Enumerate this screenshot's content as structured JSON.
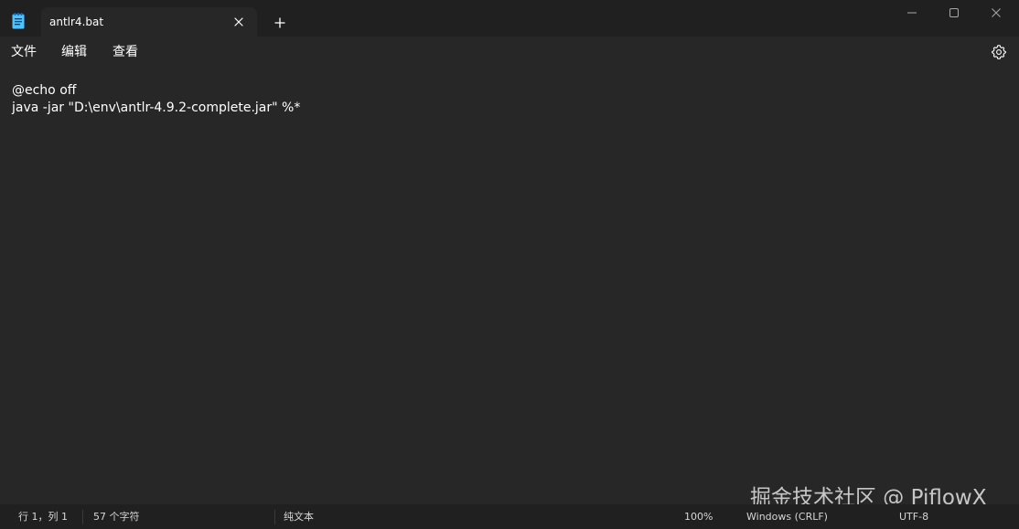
{
  "window": {
    "tab_title": "antlr4.bat",
    "icons": {
      "app": "notepad-icon",
      "tab_close": "close-icon",
      "new_tab": "plus-icon",
      "minimize": "minimize-icon",
      "maximize": "maximize-icon",
      "close": "close-icon",
      "settings": "gear-icon"
    }
  },
  "menu": {
    "file": "文件",
    "edit": "编辑",
    "view": "查看"
  },
  "editor": {
    "lines": [
      "@echo off",
      "java -jar \"D:\\env\\antlr-4.9.2-complete.jar\" %*"
    ]
  },
  "watermark": "掘金技术社区 @ PiflowX",
  "status": {
    "position": "行 1，列 1",
    "char_count": "57 个字符",
    "file_type": "纯文本",
    "zoom": "100%",
    "line_ending": "Windows (CRLF)",
    "encoding": "UTF-8"
  },
  "colors": {
    "background": "#272727",
    "chrome": "#202020",
    "text": "#ffffff",
    "icon_accent": "#4cc2ff"
  }
}
